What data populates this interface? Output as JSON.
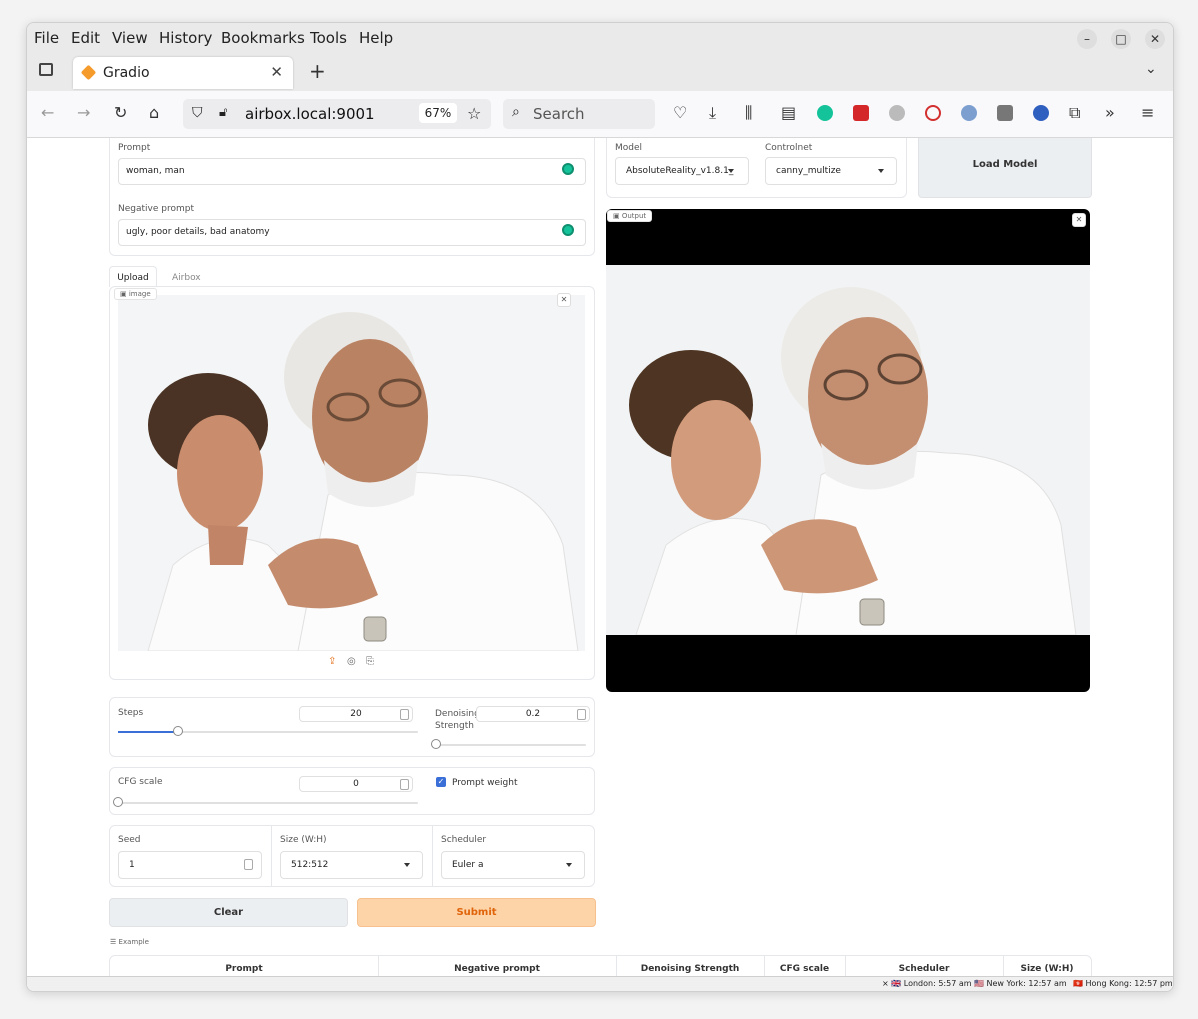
{
  "menu": [
    "File",
    "Edit",
    "View",
    "History",
    "Bookmarks",
    "Tools",
    "Help"
  ],
  "tab": {
    "title": "Gradio"
  },
  "nav": {
    "url": "airbox.local:9001",
    "zoom": "67%",
    "search_placeholder": "Search"
  },
  "prompt": {
    "label": "Prompt",
    "value": "woman, man"
  },
  "negative_prompt": {
    "label": "Negative prompt",
    "value": "ugly, poor details, bad anatomy"
  },
  "input_tabs": [
    "Upload",
    "Airbox"
  ],
  "image_label": "image",
  "model": {
    "label": "Model",
    "value": "AbsoluteReality_v1.8.1_"
  },
  "controlnet": {
    "label": "Controlnet",
    "value": "canny_multize"
  },
  "load_model_label": "Load Model",
  "output_label": "Output",
  "steps": {
    "label": "Steps",
    "value": "20",
    "fraction": 0.2
  },
  "denoising": {
    "label": "Denoising Strength",
    "value": "0.2",
    "fraction": 0.0
  },
  "cfg": {
    "label": "CFG scale",
    "value": "0",
    "fraction": 0.0
  },
  "prompt_weight": {
    "label": "Prompt weight",
    "checked": true
  },
  "seed": {
    "label": "Seed",
    "value": "1"
  },
  "size": {
    "label": "Size (W:H)",
    "value": "512:512"
  },
  "scheduler": {
    "label": "Scheduler",
    "value": "Euler a"
  },
  "buttons": {
    "clear": "Clear",
    "submit": "Submit"
  },
  "examples": {
    "label": "Example",
    "headers": [
      "Prompt",
      "Negative prompt",
      "Denoising Strength",
      "CFG scale",
      "Scheduler",
      "Size (W:H)"
    ]
  },
  "clocks": [
    "London: 5:57 am",
    "New York: 12:57 am",
    "Hong Kong: 12:57 pm"
  ],
  "colors": {
    "accent": "#3b6fd8",
    "submit": "#fdd3a8",
    "submit_text": "#e0640a",
    "grammarly": "#15c39a"
  }
}
